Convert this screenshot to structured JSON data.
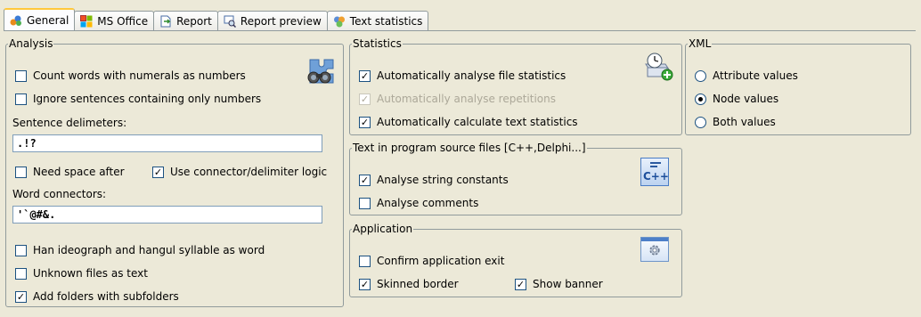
{
  "tabs": [
    {
      "label": "General",
      "icon": "general-tab-icon"
    },
    {
      "label": "MS Office",
      "icon": "ms-office-tab-icon"
    },
    {
      "label": "Report",
      "icon": "report-tab-icon"
    },
    {
      "label": "Report preview",
      "icon": "report-preview-tab-icon"
    },
    {
      "label": "Text statistics",
      "icon": "text-statistics-tab-icon"
    }
  ],
  "analysis": {
    "title": "Analysis",
    "count_numerals": {
      "label": "Count words with numerals as numbers",
      "checked": false
    },
    "ignore_sentences": {
      "label": "Ignore sentences containing only numbers",
      "checked": false
    },
    "sentence_delimiters_label": "Sentence delimeters:",
    "sentence_delimiters_value": ".!?",
    "need_space_after": {
      "label": "Need space after",
      "checked": false
    },
    "use_connector": {
      "label": "Use connector/delimiter logic",
      "checked": true
    },
    "word_connectors_label": "Word connectors:",
    "word_connectors_value": "'`@#&.",
    "han_ideograph": {
      "label": "Han ideograph and hangul syllable as word",
      "checked": false
    },
    "unknown_files": {
      "label": "Unknown files as text",
      "checked": false
    },
    "add_folders": {
      "label": "Add folders with subfolders",
      "checked": true
    }
  },
  "statistics": {
    "title": "Statistics",
    "auto_file_stats": {
      "label": "Automatically analyse file statistics",
      "checked": true
    },
    "auto_repetitions": {
      "label": "Automatically analyse repetitions",
      "checked": true,
      "disabled": true
    },
    "auto_text_stats": {
      "label": "Automatically calculate text statistics",
      "checked": true
    }
  },
  "source_files": {
    "title": "Text in program source files [C++,Delphi...]",
    "string_constants": {
      "label": "Analyse string constants",
      "checked": true
    },
    "comments": {
      "label": "Analyse comments",
      "checked": false
    },
    "icon_text": "C++"
  },
  "application": {
    "title": "Application",
    "confirm_exit": {
      "label": "Confirm application exit",
      "checked": false
    },
    "skinned_border": {
      "label": "Skinned border",
      "checked": true
    },
    "show_banner": {
      "label": "Show banner",
      "checked": true
    }
  },
  "xml": {
    "title": "XML",
    "options": [
      {
        "label": "Attribute values",
        "selected": false
      },
      {
        "label": "Node values",
        "selected": true
      },
      {
        "label": "Both values",
        "selected": false
      }
    ]
  }
}
